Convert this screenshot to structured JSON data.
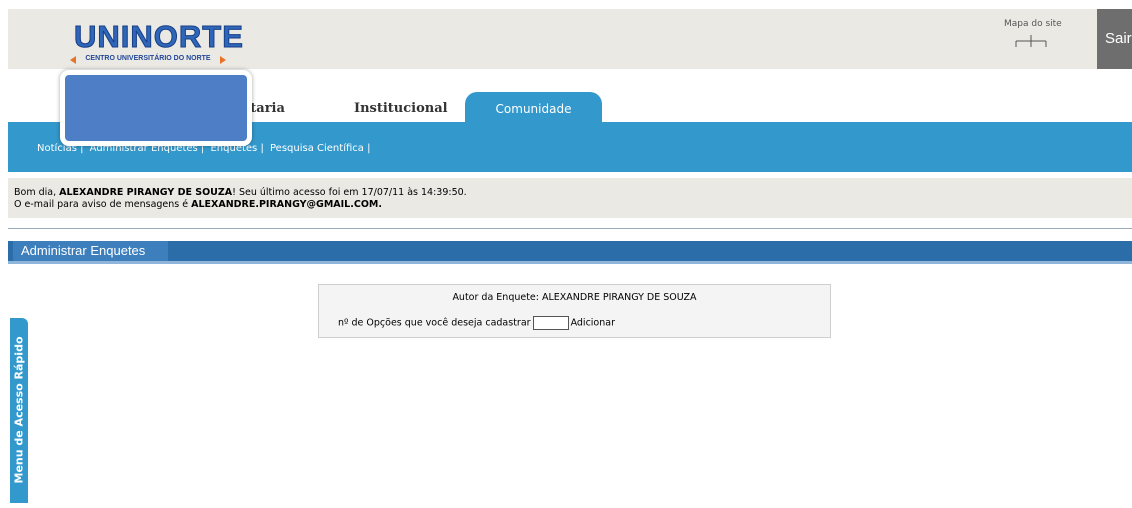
{
  "header": {
    "logo_word": "UNINORTE",
    "logo_sub": "CENTRO UNIVERSITÁRIO DO NORTE",
    "sitemap_label": "Mapa do site",
    "logout_label": "Sair"
  },
  "tabs": [
    {
      "label": "etaria"
    },
    {
      "label": "Institucional"
    },
    {
      "label": "Comunidade"
    }
  ],
  "subnav": [
    "Notícias |",
    "Administrar Enquetes |",
    "Enquetes |",
    "Pesquisa Científica |"
  ],
  "welcome": {
    "greeting": "Bom dia,",
    "user": "ALEXANDRE PIRANGY DE SOUZA",
    "last_access": "! Seu último acesso foi em 17/07/11 às 14:39:50.",
    "email_prefix": "O e-mail para aviso de mensagens é",
    "email": "ALEXANDRE.PIRANGY@GMAIL.COM."
  },
  "section": {
    "title": "Administrar Enquetes"
  },
  "form": {
    "author": "Autor da Enquete: ALEXANDRE PIRANGY DE SOUZA",
    "options_label": "nº de Opções que você deseja cadastrar",
    "options_value": "",
    "add_label": "Adicionar"
  },
  "quick_menu": {
    "label": "Menu de Acesso Rápido"
  },
  "colors": {
    "brand_blue": "#3399cc",
    "header_bg": "#ebe9e4",
    "section_blue": "#2a6da8"
  }
}
